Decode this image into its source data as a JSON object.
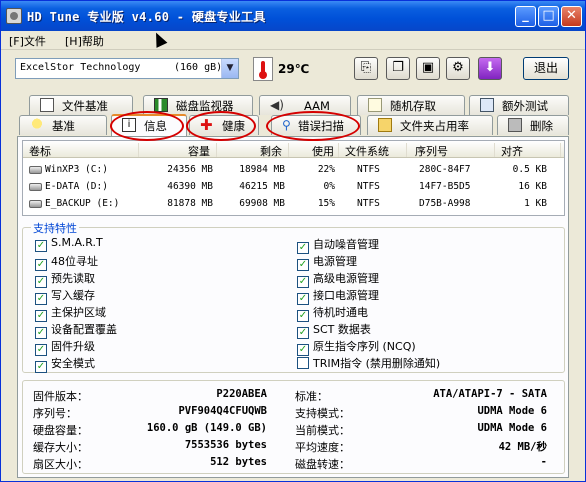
{
  "window": {
    "title": "HD Tune 专业版 v4.60 - 硬盘专业工具",
    "menu": [
      "[F]文件",
      "[H]帮助"
    ]
  },
  "toolbar": {
    "drive": "ExcelStor Technology",
    "drive_size": "(160 gB)",
    "temperature": "29℃",
    "exit_label": "退出",
    "tool_icons": [
      "copy-icon",
      "copy-alt-icon",
      "save-icon",
      "options-icon",
      "download-icon"
    ]
  },
  "tabs_row1": [
    {
      "label": "文件基准",
      "icon": "document-icon"
    },
    {
      "label": "磁盘监视器",
      "icon": "monitor-chart-icon"
    },
    {
      "label": "AAM",
      "icon": "speaker-icon"
    },
    {
      "label": "随机存取",
      "icon": "random-access-icon"
    },
    {
      "label": "额外测试",
      "icon": "extra-test-icon"
    }
  ],
  "tabs_row2": [
    {
      "label": "基准",
      "icon": "bulb-icon"
    },
    {
      "label": "信息",
      "icon": "info-icon"
    },
    {
      "label": "健康",
      "icon": "health-cross-icon"
    },
    {
      "label": "错误扫描",
      "icon": "scan-magnifier-icon"
    },
    {
      "label": "文件夹占用率",
      "icon": "folder-icon"
    },
    {
      "label": "删除",
      "icon": "trash-icon"
    }
  ],
  "volumes": {
    "columns": [
      "卷标",
      "容量",
      "剩余",
      "使用",
      "文件系统",
      "序列号",
      "对齐"
    ],
    "rows": [
      [
        "WinXP3 (C:)",
        "24356 MB",
        "18984 MB",
        "22%",
        "NTFS",
        "280C-84F7",
        "0.5 KB"
      ],
      [
        "E-DATA (D:)",
        "46390 MB",
        "46215 MB",
        "0%",
        "NTFS",
        "14F7-B5D5",
        "16 KB"
      ],
      [
        "E_BACKUP (E:)",
        "81878 MB",
        "69908 MB",
        "15%",
        "NTFS",
        "D75B-A998",
        "1 KB"
      ]
    ]
  },
  "features": {
    "title": "支持特性",
    "left": [
      {
        "label": "S.M.A.R.T",
        "checked": true
      },
      {
        "label": "48位寻址",
        "checked": true
      },
      {
        "label": "预先读取",
        "checked": true
      },
      {
        "label": "写入缓存",
        "checked": true
      },
      {
        "label": "主保护区域",
        "checked": true
      },
      {
        "label": "设备配置覆盖",
        "checked": true
      },
      {
        "label": "固件升级",
        "checked": true
      },
      {
        "label": "安全模式",
        "checked": true
      }
    ],
    "right": [
      {
        "label": "自动噪音管理",
        "checked": true
      },
      {
        "label": "电源管理",
        "checked": true
      },
      {
        "label": "高级电源管理",
        "checked": true
      },
      {
        "label": "接口电源管理",
        "checked": true
      },
      {
        "label": "待机时通电",
        "checked": true
      },
      {
        "label": "SCT 数据表",
        "checked": true
      },
      {
        "label": "原生指令序列 (NCQ)",
        "checked": true
      },
      {
        "label": "TRIM指令 (禁用删除通知)",
        "checked": false
      }
    ]
  },
  "info": {
    "left": [
      {
        "label": "固件版本：",
        "value": "P220ABEA"
      },
      {
        "label": "序列号：",
        "value": "PVF904Q4CFUQWB"
      },
      {
        "label": "硬盘容量：",
        "value": "160.0 gB (149.0 GB)"
      },
      {
        "label": "缓存大小：",
        "value": "7553536 bytes"
      },
      {
        "label": "扇区大小：",
        "value": "512 bytes"
      }
    ],
    "right": [
      {
        "label": "标准：",
        "value": "ATA/ATAPI-7 - SATA"
      },
      {
        "label": "支持模式：",
        "value": "UDMA Mode 6"
      },
      {
        "label": "当前模式：",
        "value": "UDMA Mode 6"
      },
      {
        "label": "平均速度：",
        "value": "42 MB/秒"
      },
      {
        "label": "磁盘转速：",
        "value": "-"
      }
    ]
  }
}
